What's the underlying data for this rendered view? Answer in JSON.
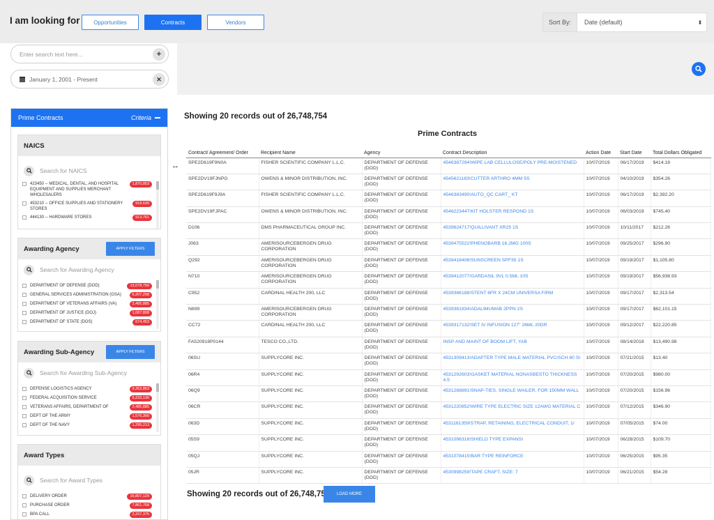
{
  "header": {
    "looking_for": "I am looking for . . .",
    "tabs": [
      "Opportunities",
      "Contracts",
      "Vendors"
    ],
    "sort_label": "Sort By:",
    "sort_value": "Date (default)"
  },
  "search": {
    "placeholder": "Enter search text here...",
    "date_range": "January 1, 2001 - Present"
  },
  "sidebar": {
    "title": "Prime Contracts",
    "criteria": "Criteria",
    "sections": [
      {
        "title": "NAICS",
        "apply": "",
        "search_placeholder": "Search for NAICS",
        "items": [
          {
            "label": "423450 -- MEDICAL, DENTAL, AND HOSPITAL EQUIPMENT AND SUPPLIES MERCHANT WHOLESALERS",
            "count": "1,870,853"
          },
          {
            "label": "453210 -- OFFICE SUPPLIES AND STATIONERY STORES",
            "count": "918,639"
          },
          {
            "label": "444130 -- HARDWARE STORES",
            "count": "913,761"
          }
        ]
      },
      {
        "title": "Awarding Agency",
        "apply": "APPLY FILTERS",
        "search_placeholder": "Search for Awarding Agency",
        "items": [
          {
            "label": "DEPARTMENT OF DEFENSE (DOD)",
            "count": "13,078,759"
          },
          {
            "label": "GENERAL SERVICES ADMINISTRATION (GSA)",
            "count": "6,207,298"
          },
          {
            "label": "DEPARTMENT OF VETERANS AFFAIRS (VA)",
            "count": "2,485,885"
          },
          {
            "label": "DEPARTMENT OF JUSTICE (DOJ)",
            "count": "1,087,808"
          },
          {
            "label": "DEPARTMENT OF STATE (DOS)",
            "count": "674,453"
          }
        ]
      },
      {
        "title": "Awarding Sub-Agency",
        "apply": "APPLY FILTERS",
        "search_placeholder": "Search for Awarding Sub-Agency",
        "items": [
          {
            "label": "DEFENSE LOGISTICS AGENCY",
            "count": "9,262,863"
          },
          {
            "label": "FEDERAL ACQUISITION SERVICE",
            "count": "5,233,130"
          },
          {
            "label": "VETERANS AFFAIRS, DEPARTMENT OF",
            "count": "2,485,885"
          },
          {
            "label": "DEPT OF THE ARMY",
            "count": "1,576,300"
          },
          {
            "label": "DEPT OF THE NAVY",
            "count": "1,295,213"
          }
        ]
      },
      {
        "title": "Award Types",
        "apply": "",
        "search_placeholder": "Search for Award Types",
        "items": [
          {
            "label": "DELIVERY ORDER",
            "count": "15,807,129"
          },
          {
            "label": "PURCHASE ORDER",
            "count": "7,861,768"
          },
          {
            "label": "BPA CALL",
            "count": "2,237,375"
          }
        ]
      }
    ]
  },
  "results": {
    "showing": "Showing 20 records out of 26,748,754",
    "table_title": "Prime Contracts",
    "columns": [
      "Contract/ Agreement/ Order",
      "Recipient Name",
      "Agency",
      "Contract Description",
      "Action Date",
      "Start Date",
      "Total Dollars Obligated"
    ],
    "rows": [
      [
        "SPE2D619F9N0A",
        "FISHER SCIENTIFIC COMPANY L.L.C.",
        "DEPARTMENT OF DEFENSE (DOD)",
        "4546387294!WIPE LAB CELLULOSE/POLY PRE-MOISTENED",
        "10/07/2019",
        "06/17/2019",
        "$414.18"
      ],
      [
        "SPE2DV19FJNPG",
        "OWENS & MINOR DISTRIBUTION, INC.",
        "DEPARTMENT OF DEFENSE (DOD)",
        "4545621183!CUTTER ARTHRO 4MM 5S",
        "10/07/2019",
        "04/10/2019",
        "$354.26"
      ],
      [
        "SPE2D619F9J9A",
        "FISHER SCIENTIFIC COMPANY L.L.C.",
        "DEPARTMENT OF DEFENSE (DOD)",
        "4546383490!AUTO_QC CART_ KT",
        "10/07/2019",
        "06/17/2019",
        "$2,392.20"
      ],
      [
        "SPE2DV19FJPAC",
        "OWENS & MINOR DISTRIBUTION, INC.",
        "DEPARTMENT OF DEFENSE (DOD)",
        "4546223447!KIT HOLSTER RESPOND 1S",
        "10/07/2019",
        "06/03/2019",
        "$745.40"
      ],
      [
        "D106",
        "DMS PHARMACEUTICAL GROUP INC.",
        "DEPARTMENT OF DEFENSE (DOD)",
        "4539624717!QUILLIVANT XR25 1S",
        "10/07/2019",
        "10/11/2017",
        "$212.26"
      ],
      [
        "J063",
        "AMERISOURCEBERGEN DRUG CORPORATION",
        "DEPARTMENT OF DEFENSE (DOD)",
        "4539475522!PHENOBARB 16.2MG 100S",
        "10/07/2019",
        "09/25/2017",
        "$296.90"
      ],
      [
        "Q292",
        "AMERISOURCEBERGEN DRUG CORPORATION",
        "DEPARTMENT OF DEFENSE (DOD)",
        "4539418406!SUNSCREEN SPF35 1S",
        "10/07/2019",
        "09/19/2017",
        "$1,105.80"
      ],
      [
        "N710",
        "AMERISOURCEBERGEN DRUG CORPORATION",
        "DEPARTMENT OF DEFENSE (DOD)",
        "4539412077!GARDASIL 9VL 0.5ML 10S",
        "10/07/2019",
        "09/19/2017",
        "$56,938.93"
      ],
      [
        "C952",
        "CARDINAL HEALTH 200, LLC",
        "DEPARTMENT OF DEFENSE (DOD)",
        "4539386188!STENT 6FR X 24CM UNIVERSA FIRM",
        "10/07/2019",
        "09/17/2017",
        "$2,313.54"
      ],
      [
        "N699",
        "AMERISOURCEBERGEN DRUG CORPORATION",
        "DEPARTMENT OF DEFENSE (DOD)",
        "4539381834!ADALIMUMAB 2PPN 2S",
        "10/07/2019",
        "09/17/2017",
        "$62,101.15"
      ],
      [
        "CC72",
        "CARDINAL HEALTH 200, LLC",
        "DEPARTMENT OF DEFENSE (DOD)",
        "4539317132!SET IV INFUSION 127\" 26ML 20DR",
        "10/07/2019",
        "09/12/2017",
        "$22,220.85"
      ],
      [
        "FA520918P0144",
        "TESCO CO.,LTD.",
        "DEPARTMENT OF DEFENSE (DOD)",
        "INSP AND MAINT OF BOOM LIFT, YAB",
        "10/07/2019",
        "08/14/2018",
        "$13,490.98"
      ],
      [
        "06SU",
        "SUPPLYCORE INC.",
        "DEPARTMENT OF DEFENSE (DOD)",
        "4531309413!ADAPTER TYPE MALE MATERIAL PVC/SCH 80 SI",
        "10/07/2019",
        "07/21/2015",
        "$13.40"
      ],
      [
        "06R4",
        "SUPPLYCORE INC.",
        "DEPARTMENT OF DEFENSE (DOD)",
        "4531292603!GASKET MATERIAL NONASBESTO THICKNESS 4.5",
        "10/07/2019",
        "07/20/2015",
        "$980.00"
      ],
      [
        "06Q9",
        "SUPPLYCORE INC.",
        "DEPARTMENT OF DEFENSE (DOD)",
        "4531288891!SNAP-TIES, SINGLE WAILER, FOR 150MM WALL",
        "10/07/2019",
        "07/20/2015",
        "$156.96"
      ],
      [
        "06CR",
        "SUPPLYCORE INC.",
        "DEPARTMENT OF DEFENSE (DOD)",
        "4531220852!WIRE TYPE ELECTRIC SIZE 12AWG MATERIAL C",
        "10/07/2019",
        "07/12/2015",
        "$346.90"
      ],
      [
        "063D",
        "SUPPLYCORE INC.",
        "DEPARTMENT OF DEFENSE (DOD)",
        "4531161359!STRAP, RETAINING, ELECTRICAL CONDUIT, 1/",
        "10/07/2019",
        "07/05/2015",
        "$74.00"
      ],
      [
        "05S9",
        "SUPPLYCORE INC.",
        "DEPARTMENT OF DEFENSE (DOD)",
        "4531096316!SHIELD TYPE EXPANSI",
        "10/07/2019",
        "06/28/2015",
        "$109.70"
      ],
      [
        "05QJ",
        "SUPPLYCORE INC.",
        "DEPARTMENT OF DEFENSE (DOD)",
        "4531078415!BAR TYPE REINFORCE",
        "10/07/2019",
        "06/25/2015",
        "$95.35"
      ],
      [
        "05JR",
        "SUPPLYCORE INC.",
        "DEPARTMENT OF DEFENSE (DOD)",
        "4530998259!TAPE CRAFT, SIZE: 7",
        "10/07/2019",
        "06/21/2015",
        "$54.28"
      ]
    ],
    "showing_bottom": "Showing 20 records out of 26,748,754",
    "load_more": "LOAD MORE"
  }
}
